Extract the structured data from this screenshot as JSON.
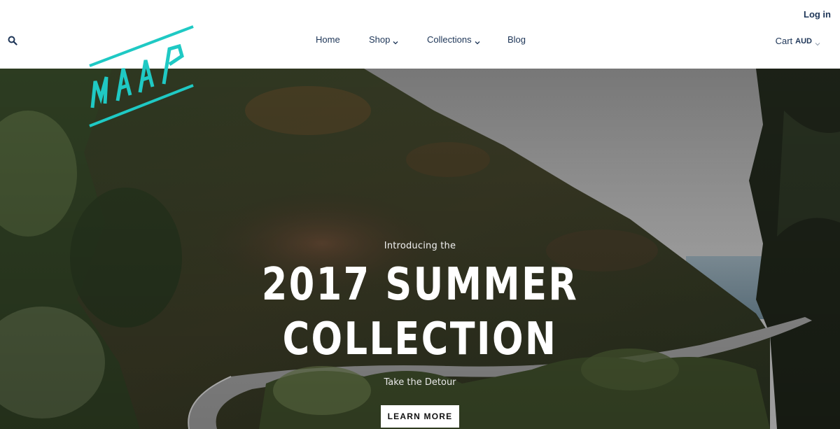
{
  "header": {
    "login_label": "Log in",
    "cart_label": "Cart",
    "currency": "AUD",
    "search_icon": "search-icon"
  },
  "nav": {
    "items": [
      {
        "label": "Home",
        "has_dropdown": false
      },
      {
        "label": "Shop",
        "has_dropdown": true
      },
      {
        "label": "Collections",
        "has_dropdown": true
      },
      {
        "label": "Blog",
        "has_dropdown": false
      }
    ]
  },
  "logo": {
    "text": "MAAP",
    "color": "#1fc9c4"
  },
  "hero": {
    "intro": "Introducing the",
    "headline_line1": "2017 SUMMER",
    "headline_line2": "COLLECTION",
    "tagline": "Take the Detour",
    "cta_label": "LEARN MORE"
  },
  "colors": {
    "nav_text": "#1d3557",
    "accent": "#1fc9c4",
    "button_bg": "#ffffff"
  }
}
